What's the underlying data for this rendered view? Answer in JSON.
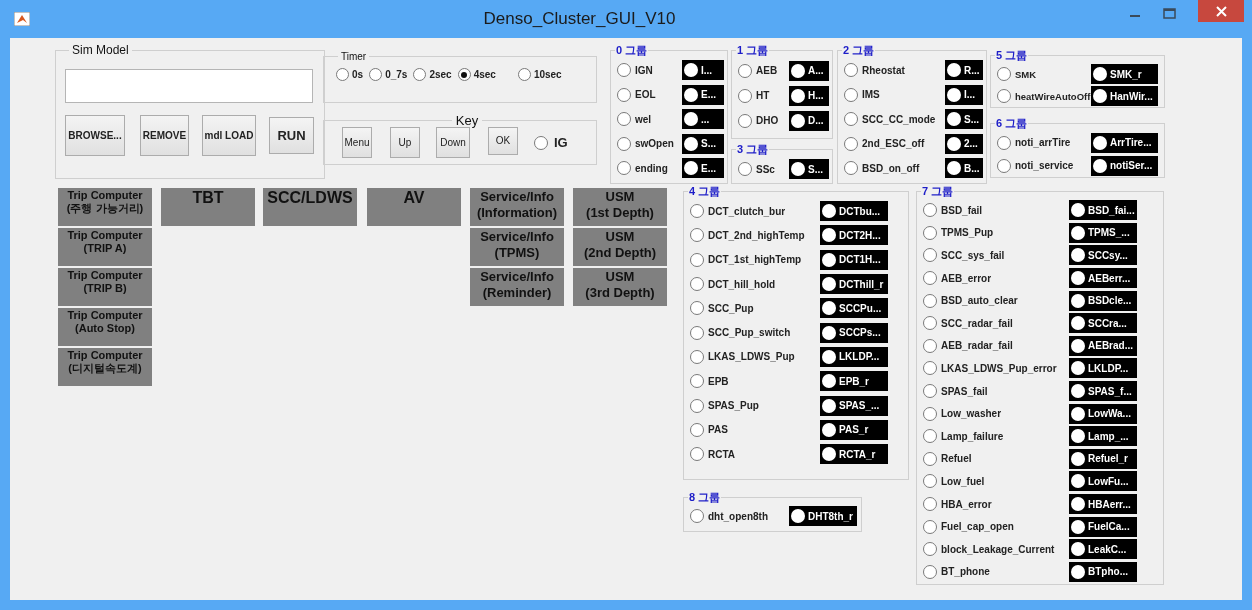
{
  "window": {
    "title": "Denso_Cluster_GUI_V10"
  },
  "sim_model": {
    "title": "Sim Model",
    "buttons": [
      "BROWSE...",
      "REMOVE",
      "mdl LOAD",
      "RUN"
    ]
  },
  "timer": {
    "title": "Timer",
    "options": [
      {
        "label": "0s",
        "selected": false
      },
      {
        "label": "0_7s",
        "selected": false
      },
      {
        "label": "2sec",
        "selected": false
      },
      {
        "label": "4sec",
        "selected": true
      },
      {
        "label": "10sec",
        "selected": false
      }
    ]
  },
  "key": {
    "title": "Key",
    "buttons": [
      "Menu",
      "Up",
      "Down",
      "OK"
    ],
    "ig": {
      "label": "IG",
      "selected": false
    }
  },
  "screen_buttons": [
    [
      "Trip Computer\n(주행 가능거리)",
      "Trip Computer\n(TRIP A)",
      "Trip Computer\n(TRIP B)",
      "Trip Computer\n(Auto Stop)",
      "Trip Computer\n(디지털속도계)"
    ],
    [
      "TBT"
    ],
    [
      "SCC/LDWS"
    ],
    [
      "AV"
    ],
    [
      "Service/Info\n(Information)",
      "Service/Info\n(TPMS)",
      "Service/Info\n(Reminder)"
    ],
    [
      "USM\n(1st Depth)",
      "USM\n(2nd Depth)",
      "USM\n(3rd Depth)"
    ]
  ],
  "groups": [
    {
      "title": "0 그룹",
      "items": [
        {
          "label": "IGN",
          "selected": false,
          "toggle": "I..."
        },
        {
          "label": "EOL",
          "selected": false,
          "toggle": "E..."
        },
        {
          "label": "wel",
          "selected": false,
          "toggle": "..."
        },
        {
          "label": "swOpen",
          "selected": false,
          "toggle": "S..."
        },
        {
          "label": "ending",
          "selected": false,
          "toggle": "E..."
        }
      ]
    },
    {
      "title": "1 그룹",
      "items": [
        {
          "label": "AEB",
          "selected": false,
          "toggle": "A..."
        },
        {
          "label": "HT",
          "selected": false,
          "toggle": "H..."
        },
        {
          "label": "DHO",
          "selected": false,
          "toggle": "D..."
        }
      ]
    },
    {
      "title": "3 그룹",
      "items": [
        {
          "label": "SSc",
          "selected": false,
          "toggle": "S..."
        }
      ]
    },
    {
      "title": "2 그룹",
      "items": [
        {
          "label": "Rheostat",
          "selected": false,
          "toggle": "R..."
        },
        {
          "label": "IMS",
          "selected": false,
          "toggle": "I..."
        },
        {
          "label": "SCC_CC_mode",
          "selected": false,
          "toggle": "S..."
        },
        {
          "label": "2nd_ESC_off",
          "selected": false,
          "toggle": "2..."
        },
        {
          "label": "BSD_on_off",
          "selected": false,
          "toggle": "B..."
        }
      ]
    },
    {
      "title": "5 그룹",
      "items": [
        {
          "label": "SMK",
          "selected": false,
          "toggle": "SMK_r"
        },
        {
          "label": "heatWireAutoOff",
          "selected": false,
          "toggle": "HanWir..."
        }
      ]
    },
    {
      "title": "6 그룹",
      "items": [
        {
          "label": "noti_arrTire",
          "selected": false,
          "toggle": "ArrTire..."
        },
        {
          "label": "noti_service",
          "selected": false,
          "toggle": "notiSer..."
        }
      ]
    },
    {
      "title": "4 그룹",
      "items": [
        {
          "label": "DCT_clutch_bur",
          "selected": false,
          "toggle": "DCTbu..."
        },
        {
          "label": "DCT_2nd_highTemp",
          "selected": false,
          "toggle": "DCT2H..."
        },
        {
          "label": "DCT_1st_highTemp",
          "selected": false,
          "toggle": "DCT1H..."
        },
        {
          "label": "DCT_hill_hold",
          "selected": false,
          "toggle": "DCThill_r"
        },
        {
          "label": "SCC_Pup",
          "selected": false,
          "toggle": "SCCPu..."
        },
        {
          "label": "SCC_Pup_switch",
          "selected": false,
          "toggle": "SCCPs..."
        },
        {
          "label": "LKAS_LDWS_Pup",
          "selected": false,
          "toggle": "LKLDP..."
        },
        {
          "label": "EPB",
          "selected": false,
          "toggle": "EPB_r"
        },
        {
          "label": "SPAS_Pup",
          "selected": false,
          "toggle": "SPAS_..."
        },
        {
          "label": "PAS",
          "selected": false,
          "toggle": "PAS_r"
        },
        {
          "label": "RCTA",
          "selected": false,
          "toggle": "RCTA_r"
        }
      ]
    },
    {
      "title": "8 그룹",
      "items": [
        {
          "label": "dht_open8th",
          "selected": false,
          "toggle": "DHT8th_r"
        }
      ]
    },
    {
      "title": "7 그룹",
      "items": [
        {
          "label": "BSD_fail",
          "selected": false,
          "toggle": "BSD_fai..."
        },
        {
          "label": "TPMS_Pup",
          "selected": false,
          "toggle": "TPMS_..."
        },
        {
          "label": "SCC_sys_fail",
          "selected": false,
          "toggle": "SCCsy..."
        },
        {
          "label": "AEB_error",
          "selected": false,
          "toggle": "AEBerr..."
        },
        {
          "label": "BSD_auto_clear",
          "selected": false,
          "toggle": "BSDcle..."
        },
        {
          "label": "SCC_radar_fail",
          "selected": false,
          "toggle": "SCCra..."
        },
        {
          "label": "AEB_radar_fail",
          "selected": false,
          "toggle": "AEBrad..."
        },
        {
          "label": "LKAS_LDWS_Pup_error",
          "selected": false,
          "toggle": "LKLDP..."
        },
        {
          "label": "SPAS_fail",
          "selected": false,
          "toggle": "SPAS_f..."
        },
        {
          "label": "Low_washer",
          "selected": false,
          "toggle": "LowWa..."
        },
        {
          "label": "Lamp_failure",
          "selected": false,
          "toggle": "Lamp_..."
        },
        {
          "label": "Refuel",
          "selected": false,
          "toggle": "Refuel_r"
        },
        {
          "label": "Low_fuel",
          "selected": false,
          "toggle": "LowFu..."
        },
        {
          "label": "HBA_error",
          "selected": false,
          "toggle": "HBAerr..."
        },
        {
          "label": "Fuel_cap_open",
          "selected": false,
          "toggle": "FuelCa..."
        },
        {
          "label": "block_Leakage_Current",
          "selected": false,
          "toggle": "LeakC..."
        },
        {
          "label": "BT_phone",
          "selected": false,
          "toggle": "BTpho..."
        }
      ]
    }
  ]
}
